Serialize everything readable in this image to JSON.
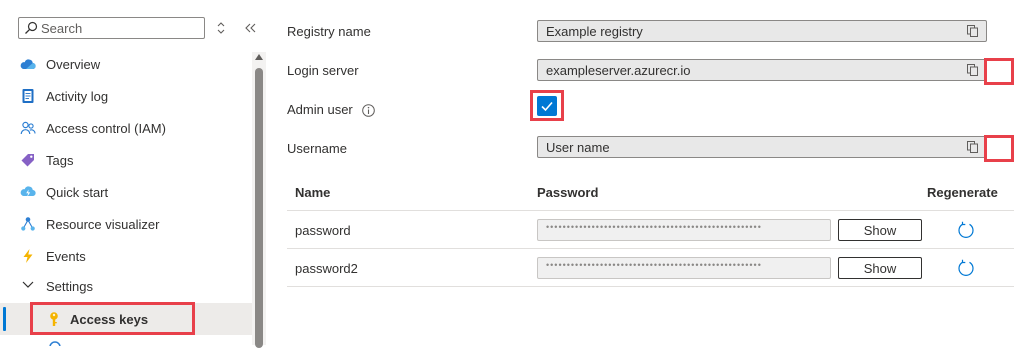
{
  "sidebar": {
    "search": {
      "placeholder": "Search"
    },
    "items": [
      {
        "id": "overview",
        "label": "Overview",
        "icon": "cloud-icon"
      },
      {
        "id": "activity-log",
        "label": "Activity log",
        "icon": "log-icon"
      },
      {
        "id": "access-control",
        "label": "Access control (IAM)",
        "icon": "people-icon"
      },
      {
        "id": "tags",
        "label": "Tags",
        "icon": "tag-icon"
      },
      {
        "id": "quick-start",
        "label": "Quick start",
        "icon": "cloud-bolt-icon"
      },
      {
        "id": "resource-visualizer",
        "label": "Resource visualizer",
        "icon": "hierarchy-icon"
      },
      {
        "id": "events",
        "label": "Events",
        "icon": "lightning-icon"
      }
    ],
    "settings_group": {
      "label": "Settings",
      "expanded": true
    },
    "selected_item": {
      "label": "Access keys",
      "icon": "key-icon"
    }
  },
  "form": {
    "registry_name": {
      "label": "Registry name",
      "value": "Example registry"
    },
    "login_server": {
      "label": "Login server",
      "value": "exampleserver.azurecr.io"
    },
    "admin_user": {
      "label": "Admin user",
      "checked": true
    },
    "username": {
      "label": "Username",
      "value": "User name"
    }
  },
  "passwords": {
    "headers": {
      "name": "Name",
      "password": "Password",
      "regenerate": "Regenerate"
    },
    "rows": [
      {
        "name": "password",
        "masked": "••••••••••••••••••••••••••••••••••••••••••••••••••••",
        "show_label": "Show"
      },
      {
        "name": "password2",
        "masked": "••••••••••••••••••••••••••••••••••••••••••••••••••••",
        "show_label": "Show"
      }
    ]
  },
  "colors": {
    "accent": "#0078d4",
    "highlight": "#e8404a",
    "selected_bg": "#edebe9",
    "readonly_bg": "#e8e8e8"
  }
}
